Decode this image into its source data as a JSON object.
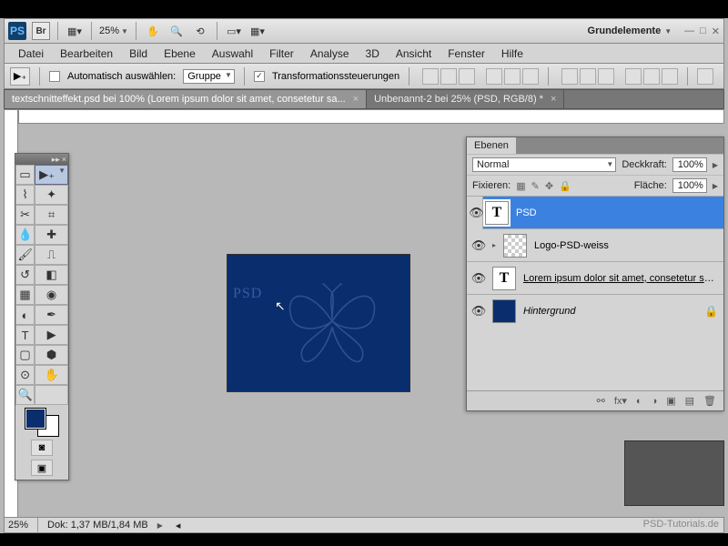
{
  "topbar": {
    "ps": "PS",
    "br": "Br",
    "zoom": "25%",
    "workspace": "Grundelemente"
  },
  "menu": [
    "Datei",
    "Bearbeiten",
    "Bild",
    "Ebene",
    "Auswahl",
    "Filter",
    "Analyse",
    "3D",
    "Ansicht",
    "Fenster",
    "Hilfe"
  ],
  "options": {
    "auto": "Automatisch auswählen:",
    "group": "Gruppe",
    "transform": "Transformationssteuerungen"
  },
  "tabs": [
    {
      "label": "textschnitteffekt.psd bei 100% (Lorem ipsum dolor sit amet, consetetur sa...",
      "active": true
    },
    {
      "label": "Unbenannt-2 bei 25% (PSD, RGB/8) *",
      "active": false
    }
  ],
  "doc": {
    "psd": "PSD"
  },
  "status": {
    "zoom": "25%",
    "info": "Dok: 1,37 MB/1,84 MB"
  },
  "watermark": "PSD-Tutorials.de",
  "layers": {
    "title": "Ebenen",
    "mode": "Normal",
    "opacityLabel": "Deckkraft:",
    "opacity": "100%",
    "lockLabel": "Fixieren:",
    "fillLabel": "Fläche:",
    "fill": "100%",
    "items": [
      {
        "name": "PSD",
        "type": "T",
        "active": true
      },
      {
        "name": "Logo-PSD-weiss",
        "type": "check"
      },
      {
        "name": "Lorem ipsum dolor sit amet, consetetur sadips...",
        "type": "T",
        "underline": true
      },
      {
        "name": "Hintergrund",
        "type": "blue",
        "italic": true,
        "locked": true
      }
    ]
  },
  "colors": {
    "fg": "#0a2d6e",
    "bg": "#ffffff"
  }
}
